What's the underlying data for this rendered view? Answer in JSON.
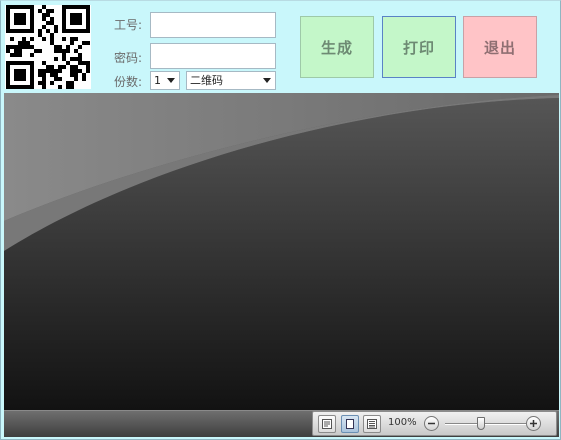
{
  "form": {
    "employee_id_label": "工号:",
    "employee_id_value": "",
    "password_label": "密码:",
    "password_value": "",
    "copies_label": "份数:",
    "copies_value": "1",
    "code_type_value": "二维码"
  },
  "buttons": {
    "generate_label": "生成",
    "print_label": "打印",
    "exit_label": "退出"
  },
  "statusbar": {
    "zoom_text": "100%",
    "zoom_level_percent": 100
  },
  "icons": {
    "qr": "qr-code-icon",
    "page_setup": "page-setup-icon",
    "single_page": "single-page-icon",
    "multi_page": "multi-page-icon",
    "zoom_out": "zoom-out-icon",
    "zoom_in": "zoom-in-icon",
    "dropdown": "chevron-down-icon"
  },
  "colors": {
    "window_bg": "#c9f7fb",
    "generate_bg": "#c4f7c9",
    "print_bg": "#c4f7c9",
    "exit_bg": "#ffc4c7"
  }
}
